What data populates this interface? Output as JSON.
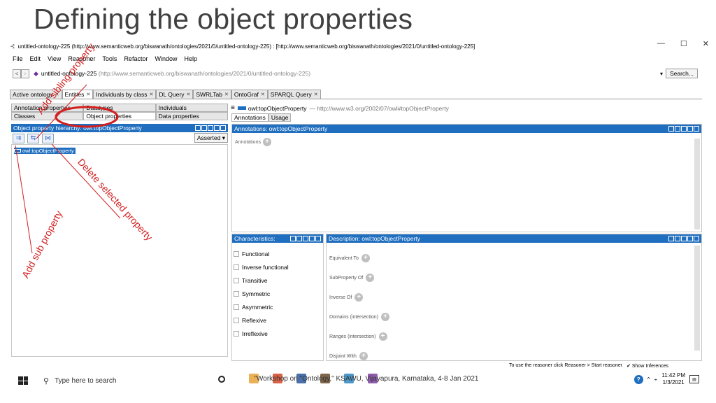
{
  "slide": {
    "title": "Defining the object properties"
  },
  "window": {
    "title": "untitled-ontology-225 (http://www.semanticweb.org/biswanath/ontologies/2021/0/untitled-ontology-225) : [http://www.semanticweb.org/biswanath/ontologies/2021/0/untitled-ontology-225]",
    "minimize": "—",
    "maximize": "☐",
    "close": "✕"
  },
  "menu": [
    "File",
    "Edit",
    "View",
    "Reasoner",
    "Tools",
    "Refactor",
    "Window",
    "Help"
  ],
  "address": {
    "back": "<",
    "forward": ">",
    "name": "untitled-ontology-225",
    "iri": "(http://www.semanticweb.org/biswanath/ontologies/2021/0/untitled-ontology-225)",
    "search_label": "Search..."
  },
  "tabs": [
    "Active ontology",
    "Entities",
    "Individuals by class",
    "DL Query",
    "SWRLTab",
    "OntoGraf",
    "SPARQL Query"
  ],
  "left": {
    "tabs_row1": [
      "Annotation properties",
      "Datatypes",
      "Individuals"
    ],
    "tabs_row2": [
      "Classes",
      "Object properties",
      "Data properties"
    ],
    "header": "Object property hierarchy: owl:topObjectProperty",
    "asserted": "Asserted ▾",
    "tree_item": "owl:topObjectProperty"
  },
  "right": {
    "entity": "owl:topObjectProperty",
    "entity_iri": "— http://www.w3.org/2002/07/owl#topObjectProperty",
    "tabs": [
      "Annotations",
      "Usage"
    ],
    "annotations_header": "Annotations: owl:topObjectProperty",
    "annotations_label": "Annotations",
    "characteristics_header": "Characteristics:",
    "characteristics": [
      "Functional",
      "Inverse functional",
      "Transitive",
      "Symmetric",
      "Asymmetric",
      "Reflexive",
      "Irreflexive"
    ],
    "description_header": "Description: owl:topObjectProperty",
    "description_items": [
      "Equivalent To",
      "SubProperty Of",
      "Inverse Of",
      "Domains (intersection)",
      "Ranges (intersection)",
      "Disjoint With"
    ]
  },
  "status": {
    "reasoner": "To use the reasoner click Reasoner > Start reasoner",
    "show_inferences": "✔ Show Inferences"
  },
  "taskbar": {
    "search_placeholder": "Type here to search",
    "footer": "\"Workshop on \"Ontology,\" KSAWU, Vijayapura, Karnataka, 4-8 Jan 2021",
    "time": "11:42 PM",
    "date": "1/3/2021"
  },
  "annotations": {
    "add_sibling": "Add sibling property",
    "delete": "Delete selected property",
    "add_sub": "Add sub property"
  },
  "colors": {
    "accent": "#1f6ebf",
    "annotation": "#d21f1f"
  }
}
